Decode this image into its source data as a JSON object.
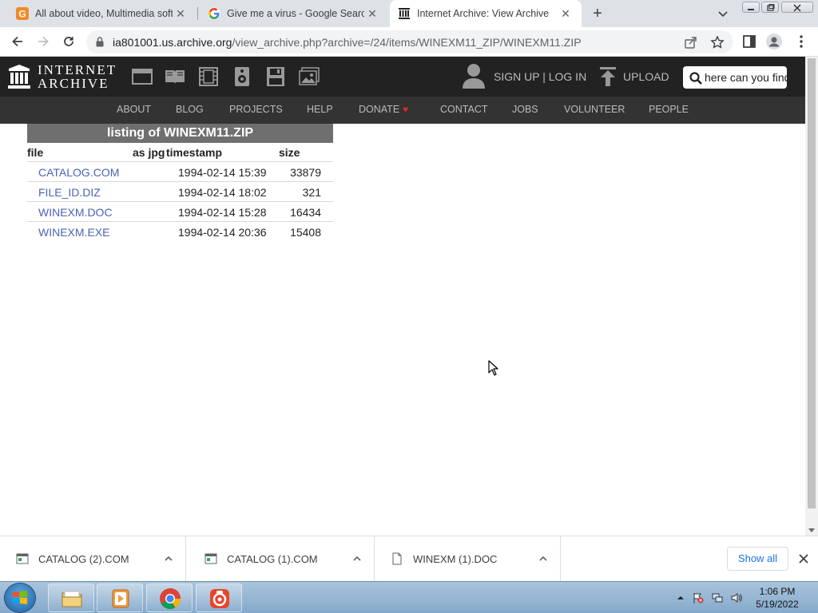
{
  "browser": {
    "tabs": [
      {
        "title": "All about video, Multimedia software",
        "icon": "g-orange-favicon",
        "active": false
      },
      {
        "title": "Give me a virus - Google Search",
        "icon": "google-favicon",
        "active": false
      },
      {
        "title": "Internet Archive: View Archive",
        "icon": "internet-archive-favicon",
        "active": true
      }
    ],
    "url_host": "ia801001.us.archive.org",
    "url_path": "/view_archive.php?archive=/24/items/WINEXM11_ZIP/WINEXM11.ZIP"
  },
  "ia": {
    "logo_line1": "INTERNET",
    "logo_line2": "ARCHIVE",
    "signup": "SIGN UP | LOG IN",
    "upload": "UPLOAD",
    "search_value": "here can you find",
    "nav": [
      "ABOUT",
      "BLOG",
      "PROJECTS",
      "HELP",
      "DONATE",
      "CONTACT",
      "JOBS",
      "VOLUNTEER",
      "PEOPLE"
    ]
  },
  "listing": {
    "title": "listing of WINEXM11.ZIP",
    "headers": {
      "file": "file",
      "jpg": "as jpg",
      "timestamp": "timestamp",
      "size": "size"
    },
    "rows": [
      {
        "file": "CATALOG.COM",
        "timestamp": "1994-02-14 15:39",
        "size": "33879"
      },
      {
        "file": "FILE_ID.DIZ",
        "timestamp": "1994-02-14 18:02",
        "size": "321"
      },
      {
        "file": "WINEXM.DOC",
        "timestamp": "1994-02-14 15:28",
        "size": "16434"
      },
      {
        "file": "WINEXM.EXE",
        "timestamp": "1994-02-14 20:36",
        "size": "15408"
      }
    ]
  },
  "downloads": {
    "items": [
      {
        "name": "CATALOG (2).COM"
      },
      {
        "name": "CATALOG (1).COM"
      },
      {
        "name": "WINEXM (1).DOC"
      }
    ],
    "show_all": "Show all"
  },
  "taskbar": {
    "time": "1:06 PM",
    "date": "5/19/2022"
  },
  "colors": {
    "ia_dark": "#222222",
    "ia_nav": "#333333",
    "listing_title_bg": "#6f6f6f",
    "link": "#4b64b4",
    "donate_heart": "#d92b2b"
  }
}
